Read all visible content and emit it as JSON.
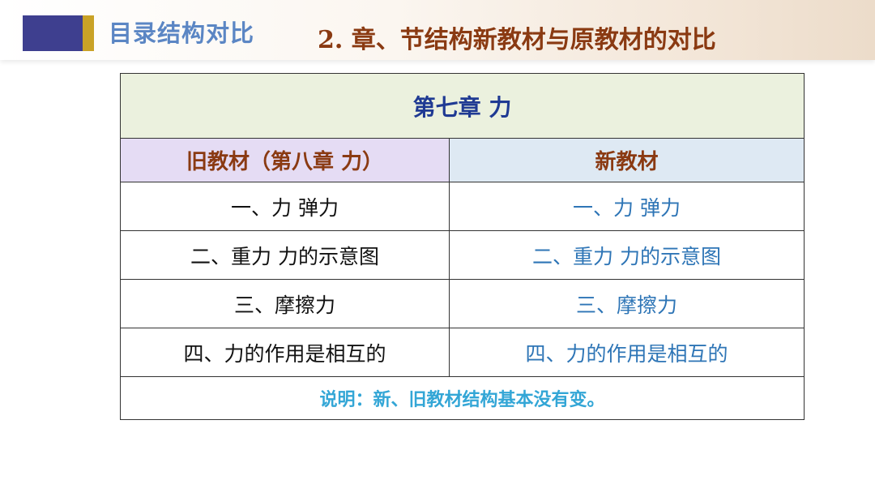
{
  "header": {
    "section_title": "目录结构对比",
    "slide_title": "2. 章、节结构新教材与原教材的对比"
  },
  "table": {
    "chapter_title": "第七章 力",
    "old_header": "旧教材（第八章 力）",
    "new_header": "新教材",
    "rows": [
      {
        "old": "一、力 弹力",
        "new": "一、力 弹力"
      },
      {
        "old": "二、重力 力的示意图",
        "new": "二、重力 力的示意图"
      },
      {
        "old": "三、摩擦力",
        "new": "三、摩擦力"
      },
      {
        "old": "四、力的作用是相互的",
        "new": "四、力的作用是相互的"
      }
    ],
    "note": "说明：新、旧教材结构基本没有变。"
  },
  "colors": {
    "accent_block": "#3e3f8f",
    "accent_stripe": "#c9a227",
    "section_title": "#5b86c4",
    "slide_title": "#8a3a12",
    "new_text": "#2e75b6",
    "note_text": "#33a6d6"
  }
}
